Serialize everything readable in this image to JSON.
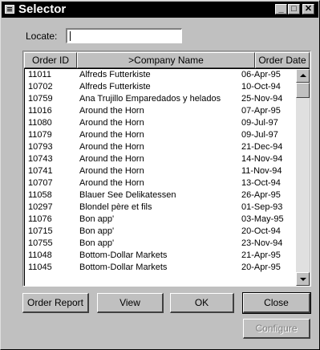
{
  "window": {
    "title": "Selector",
    "min_glyph": "_",
    "max_glyph": "□",
    "close_glyph": "✕"
  },
  "locate": {
    "label": "Locate:",
    "value": ""
  },
  "columns": [
    "Order ID",
    ">Company Name",
    "Order Date"
  ],
  "rows": [
    {
      "order_id": "11011",
      "company": "Alfreds Futterkiste",
      "order_date": "06-Apr-95"
    },
    {
      "order_id": "10702",
      "company": "Alfreds Futterkiste",
      "order_date": "10-Oct-94"
    },
    {
      "order_id": "10759",
      "company": "Ana Trujillo Emparedados y helados",
      "order_date": "25-Nov-94"
    },
    {
      "order_id": "11016",
      "company": "Around the Horn",
      "order_date": "07-Apr-95"
    },
    {
      "order_id": "11080",
      "company": "Around the Horn",
      "order_date": "09-Jul-97"
    },
    {
      "order_id": "11079",
      "company": "Around the Horn",
      "order_date": "09-Jul-97"
    },
    {
      "order_id": "10793",
      "company": "Around the Horn",
      "order_date": "21-Dec-94"
    },
    {
      "order_id": "10743",
      "company": "Around the Horn",
      "order_date": "14-Nov-94"
    },
    {
      "order_id": "10741",
      "company": "Around the Horn",
      "order_date": "11-Nov-94"
    },
    {
      "order_id": "10707",
      "company": "Around the Horn",
      "order_date": "13-Oct-94"
    },
    {
      "order_id": "11058",
      "company": "Blauer See Delikatessen",
      "order_date": "26-Apr-95"
    },
    {
      "order_id": "10297",
      "company": "Blondel père et fils",
      "order_date": "01-Sep-93"
    },
    {
      "order_id": "11076",
      "company": "Bon app'",
      "order_date": "03-May-95"
    },
    {
      "order_id": "10715",
      "company": "Bon app'",
      "order_date": "20-Oct-94"
    },
    {
      "order_id": "10755",
      "company": "Bon app'",
      "order_date": "23-Nov-94"
    },
    {
      "order_id": "11048",
      "company": "Bottom-Dollar Markets",
      "order_date": "21-Apr-95"
    },
    {
      "order_id": "11045",
      "company": "Bottom-Dollar Markets",
      "order_date": "20-Apr-95"
    }
  ],
  "buttons": {
    "order_report": "Order Report",
    "view": "View",
    "ok": "OK",
    "close": "Close",
    "configure": "Configure"
  }
}
